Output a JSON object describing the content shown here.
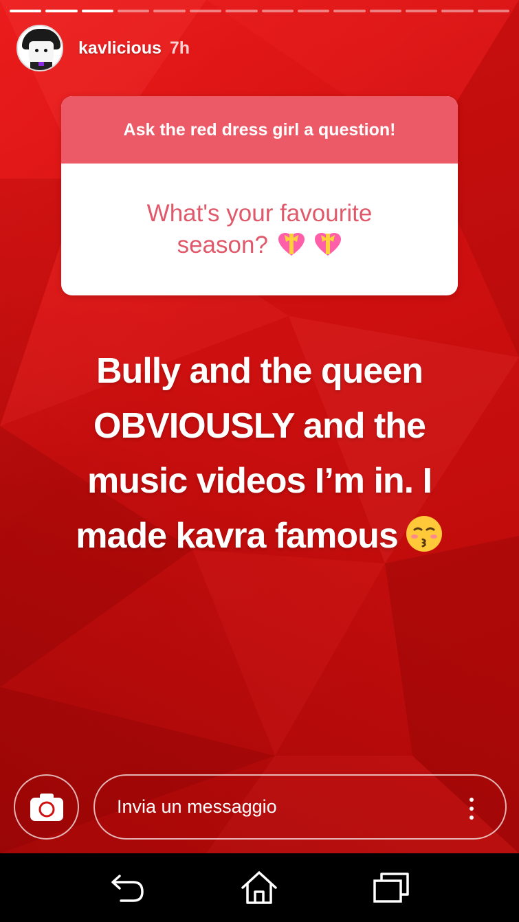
{
  "story": {
    "progress_segments": 14,
    "progress_done": 3,
    "username": "kavlicious",
    "time": "7h"
  },
  "question_card": {
    "title": "Ask the red dress girl a question!",
    "question": "What's your favourite season?",
    "question_emoji": "heart-with-ribbon-emoji"
  },
  "answer": {
    "line1": "Bully and the queen",
    "line2": "OBVIOUSLY and the",
    "line3": "music videos I’m in. I",
    "line4": "made kavra famous",
    "emoji": "kissing-face-emoji"
  },
  "reply_bar": {
    "placeholder": "Invia un messaggio"
  },
  "colors": {
    "background": "#d11010",
    "card_header": "#ec5a67",
    "card_text": "#e0596a"
  },
  "nav": {
    "icons": [
      "back-icon",
      "home-icon",
      "recents-icon"
    ]
  }
}
